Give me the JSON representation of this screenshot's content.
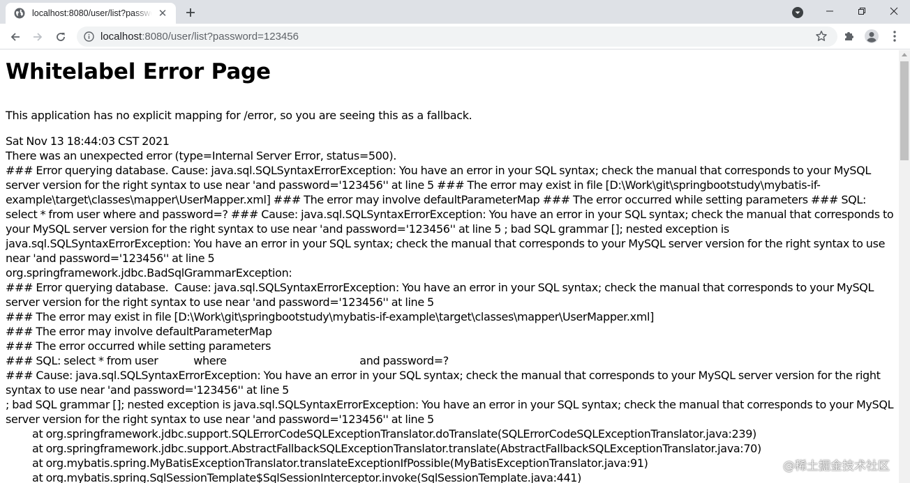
{
  "browser": {
    "tab_title": "localhost:8080/user/list?password=123456",
    "url_host": "localhost",
    "url_path": ":8080/user/list?password=123456",
    "colors": {
      "tabstrip": "#dee1e6",
      "omnibox": "#f1f3f4",
      "icon": "#5f6368"
    }
  },
  "page": {
    "title": "Whitelabel Error Page",
    "intro": "This application has no explicit mapping for /error, so you are seeing this as a fallback.",
    "timestamp": "Sat Nov 13 18:44:03 CST 2021",
    "lines": [
      "There was an unexpected error (type=Internal Server Error, status=500).",
      "### Error querying database. Cause: java.sql.SQLSyntaxErrorException: You have an error in your SQL syntax; check the manual that corresponds to your MySQL server version for the right syntax to use near 'and password='123456'' at line 5 ### The error may exist in file [D:\\Work\\git\\springbootstudy\\mybatis-if-example\\target\\classes\\mapper\\UserMapper.xml] ### The error may involve defaultParameterMap ### The error occurred while setting parameters ### SQL: select * from user where and password=? ### Cause: java.sql.SQLSyntaxErrorException: You have an error in your SQL syntax; check the manual that corresponds to your MySQL server version for the right syntax to use near 'and password='123456'' at line 5 ; bad SQL grammar []; nested exception is java.sql.SQLSyntaxErrorException: You have an error in your SQL syntax; check the manual that corresponds to your MySQL server version for the right syntax to use near 'and password='123456'' at line 5",
      "org.springframework.jdbc.BadSqlGrammarException:",
      "### Error querying database.  Cause: java.sql.SQLSyntaxErrorException: You have an error in your SQL syntax; check the manual that corresponds to your MySQL server version for the right syntax to use near 'and password='123456'' at line 5",
      "### The error may exist in file [D:\\Work\\git\\springbootstudy\\mybatis-if-example\\target\\classes\\mapper\\UserMapper.xml]",
      "### The error may involve defaultParameterMap",
      "### The error occurred while setting parameters",
      "### SQL: select * from user            where                                             and password=?",
      "### Cause: java.sql.SQLSyntaxErrorException: You have an error in your SQL syntax; check the manual that corresponds to your MySQL server version for the right syntax to use near 'and password='123456'' at line 5",
      "; bad SQL grammar []; nested exception is java.sql.SQLSyntaxErrorException: You have an error in your SQL syntax; check the manual that corresponds to your MySQL server version for the right syntax to use near 'and password='123456'' at line 5"
    ],
    "trace": [
      "at org.springframework.jdbc.support.SQLErrorCodeSQLExceptionTranslator.doTranslate(SQLErrorCodeSQLExceptionTranslator.java:239)",
      "at org.springframework.jdbc.support.AbstractFallbackSQLExceptionTranslator.translate(AbstractFallbackSQLExceptionTranslator.java:70)",
      "at org.mybatis.spring.MyBatisExceptionTranslator.translateExceptionIfPossible(MyBatisExceptionTranslator.java:91)",
      "at org.mybatis.spring.SqlSessionTemplate$SqlSessionInterceptor.invoke(SqlSessionTemplate.java:441)"
    ]
  },
  "watermark": "@稀土掘金技术社区"
}
